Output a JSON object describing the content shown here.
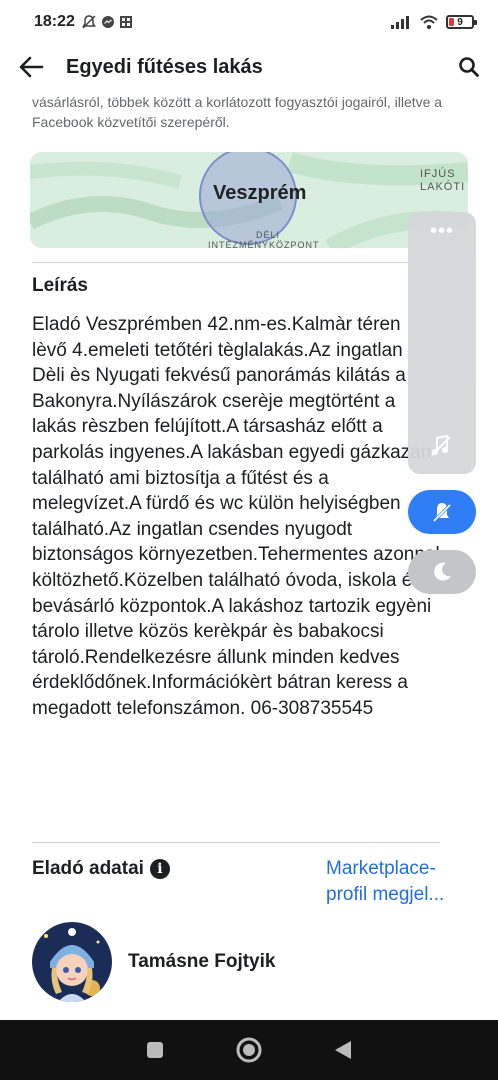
{
  "status_bar": {
    "time": "18:22",
    "battery_level": "9"
  },
  "header": {
    "title": "Egyedi fűtéses lakás"
  },
  "notice_text": "vásárlásról, többek között a korlátozott fogyasztói jogairól, illetve a Facebook közvetítői szerepéről.",
  "map": {
    "city_label": "Veszprém",
    "label_ifjus": "IFJÚS",
    "label_lakoti": "LAKÓTI",
    "label_deli": "DÉLI",
    "label_intezmeny": "INTÉZMÉNYKÖZPONT"
  },
  "description": {
    "heading": "Leírás",
    "text": "Eladó Veszprémben 42.nm-es.Kalmàr téren lèvő 4.emeleti tetőtéri tèglalakás.Az ingatlan Dèli ès Nyugati fekvésű panorámás kilátás a Bakonyra.Nyílászárok cserèje megtörtént a lakás rèszben felújított.A társasház előtt a parkolás ingyenes.A lakásban egyedi gázkazán található ami biztosítja a fűtést és a melegvízet.A fürdő és wc külön helyiségben található.Az ingatlan csendes nyugodt biztonságos környezetben.Tehermentes azonnal költözhető.Közelben található óvoda, iskola és bevásárló központok.A lakáshoz tartozik egyèni tárolo illetve közös kerèkpár ès babakocsi tároló.Rendelkezésre állunk minden kedves érdeklődőnek.Információkèrt bátran keress a megadott telefonszámon. 06-308735545"
  },
  "seller": {
    "heading": "Eladó adatai",
    "info_icon_glyph": "i",
    "profile_link": "Marketplace-profil megjel...",
    "name": "Tamásne Fojtyik"
  },
  "side_panel": {
    "dots": "•••"
  },
  "colors": {
    "link": "#216fdb",
    "accent_blue": "#2f7ef5",
    "map_bg": "#d7ecde"
  }
}
